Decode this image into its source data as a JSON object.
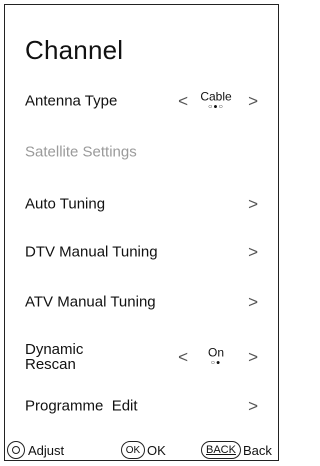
{
  "menu": {
    "title": "Channel",
    "items": [
      {
        "label": "Antenna Type",
        "value": "Cable",
        "value_dots": "○●○",
        "has_left": true,
        "has_right": true,
        "enabled": true
      },
      {
        "label": "Satellite Settings",
        "enabled": false
      },
      {
        "label": "Auto Tuning",
        "has_right": true,
        "enabled": true
      },
      {
        "label": "DTV Manual Tuning",
        "has_right": true,
        "enabled": true
      },
      {
        "label": "ATV Manual Tuning",
        "has_right": true,
        "enabled": true
      },
      {
        "label_line1": "Dynamic",
        "label_line2": "Rescan",
        "value": "On",
        "value_dots": "○●",
        "has_left": true,
        "has_right": true,
        "enabled": true
      },
      {
        "label": "Programme  Edit",
        "has_right": true,
        "enabled": true
      }
    ]
  },
  "icons": {
    "chevron_left": "chevron-left-icon",
    "chevron_right": "chevron-right-icon",
    "dpad": "dpad-icon",
    "ok": "ok-button-icon",
    "back": "back-button-icon"
  },
  "footer": {
    "adjust_label": "Adjust",
    "ok_icon_text": "OK",
    "ok_label": "OK",
    "back_icon_text": "BACK",
    "back_label": "Back"
  },
  "glyphs": {
    "left": "<",
    "right": ">"
  }
}
